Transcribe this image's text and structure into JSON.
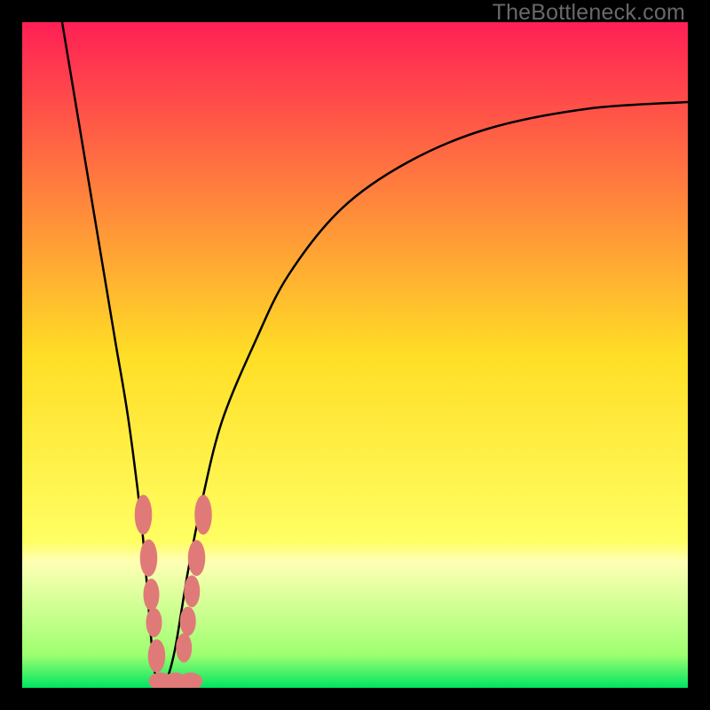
{
  "watermark": "TheBottleneck.com",
  "chart_data": {
    "type": "line",
    "title": "",
    "xlabel": "",
    "ylabel": "",
    "xlim": [
      0,
      100
    ],
    "ylim": [
      0,
      100
    ],
    "grid": false,
    "legend": false,
    "background_gradient": {
      "stops": [
        {
          "pos": 0.0,
          "color": "#ff1f55"
        },
        {
          "pos": 0.5,
          "color": "#ffde26"
        },
        {
          "pos": 0.78,
          "color": "#ffff63"
        },
        {
          "pos": 0.81,
          "color": "#ffffb5"
        },
        {
          "pos": 0.95,
          "color": "#9fff70"
        },
        {
          "pos": 1.0,
          "color": "#00e561"
        }
      ]
    },
    "series": [
      {
        "name": "left-branch",
        "x": [
          6,
          8,
          10,
          12,
          14,
          16,
          18,
          19,
          19.5,
          20,
          21
        ],
        "y": [
          100,
          88,
          76,
          64,
          52,
          40,
          24,
          12,
          6,
          2,
          0
        ]
      },
      {
        "name": "right-branch",
        "x": [
          21,
          22,
          23,
          24,
          25,
          27,
          30,
          35,
          40,
          48,
          58,
          70,
          85,
          100
        ],
        "y": [
          0,
          2,
          6,
          12,
          18,
          28,
          40,
          52,
          62,
          72,
          79,
          84,
          87,
          88
        ]
      }
    ],
    "markers": [
      {
        "x": 18.2,
        "y": 26.0,
        "rx": 1.3,
        "ry": 3.0
      },
      {
        "x": 19.0,
        "y": 19.5,
        "rx": 1.3,
        "ry": 2.8
      },
      {
        "x": 19.4,
        "y": 14.0,
        "rx": 1.2,
        "ry": 2.4
      },
      {
        "x": 19.8,
        "y": 9.8,
        "rx": 1.2,
        "ry": 2.2
      },
      {
        "x": 20.2,
        "y": 4.8,
        "rx": 1.3,
        "ry": 2.5
      },
      {
        "x": 20.8,
        "y": 1.0,
        "rx": 1.8,
        "ry": 1.3
      },
      {
        "x": 23.0,
        "y": 1.0,
        "rx": 1.8,
        "ry": 1.3
      },
      {
        "x": 25.3,
        "y": 1.0,
        "rx": 1.8,
        "ry": 1.3
      },
      {
        "x": 24.3,
        "y": 6.0,
        "rx": 1.2,
        "ry": 2.2
      },
      {
        "x": 24.9,
        "y": 10.0,
        "rx": 1.2,
        "ry": 2.2
      },
      {
        "x": 25.5,
        "y": 14.5,
        "rx": 1.2,
        "ry": 2.4
      },
      {
        "x": 26.2,
        "y": 19.5,
        "rx": 1.3,
        "ry": 2.7
      },
      {
        "x": 27.2,
        "y": 26.0,
        "rx": 1.3,
        "ry": 3.0
      }
    ],
    "curve_stroke_px": 2.5,
    "marker_fill": "#e07a79"
  }
}
